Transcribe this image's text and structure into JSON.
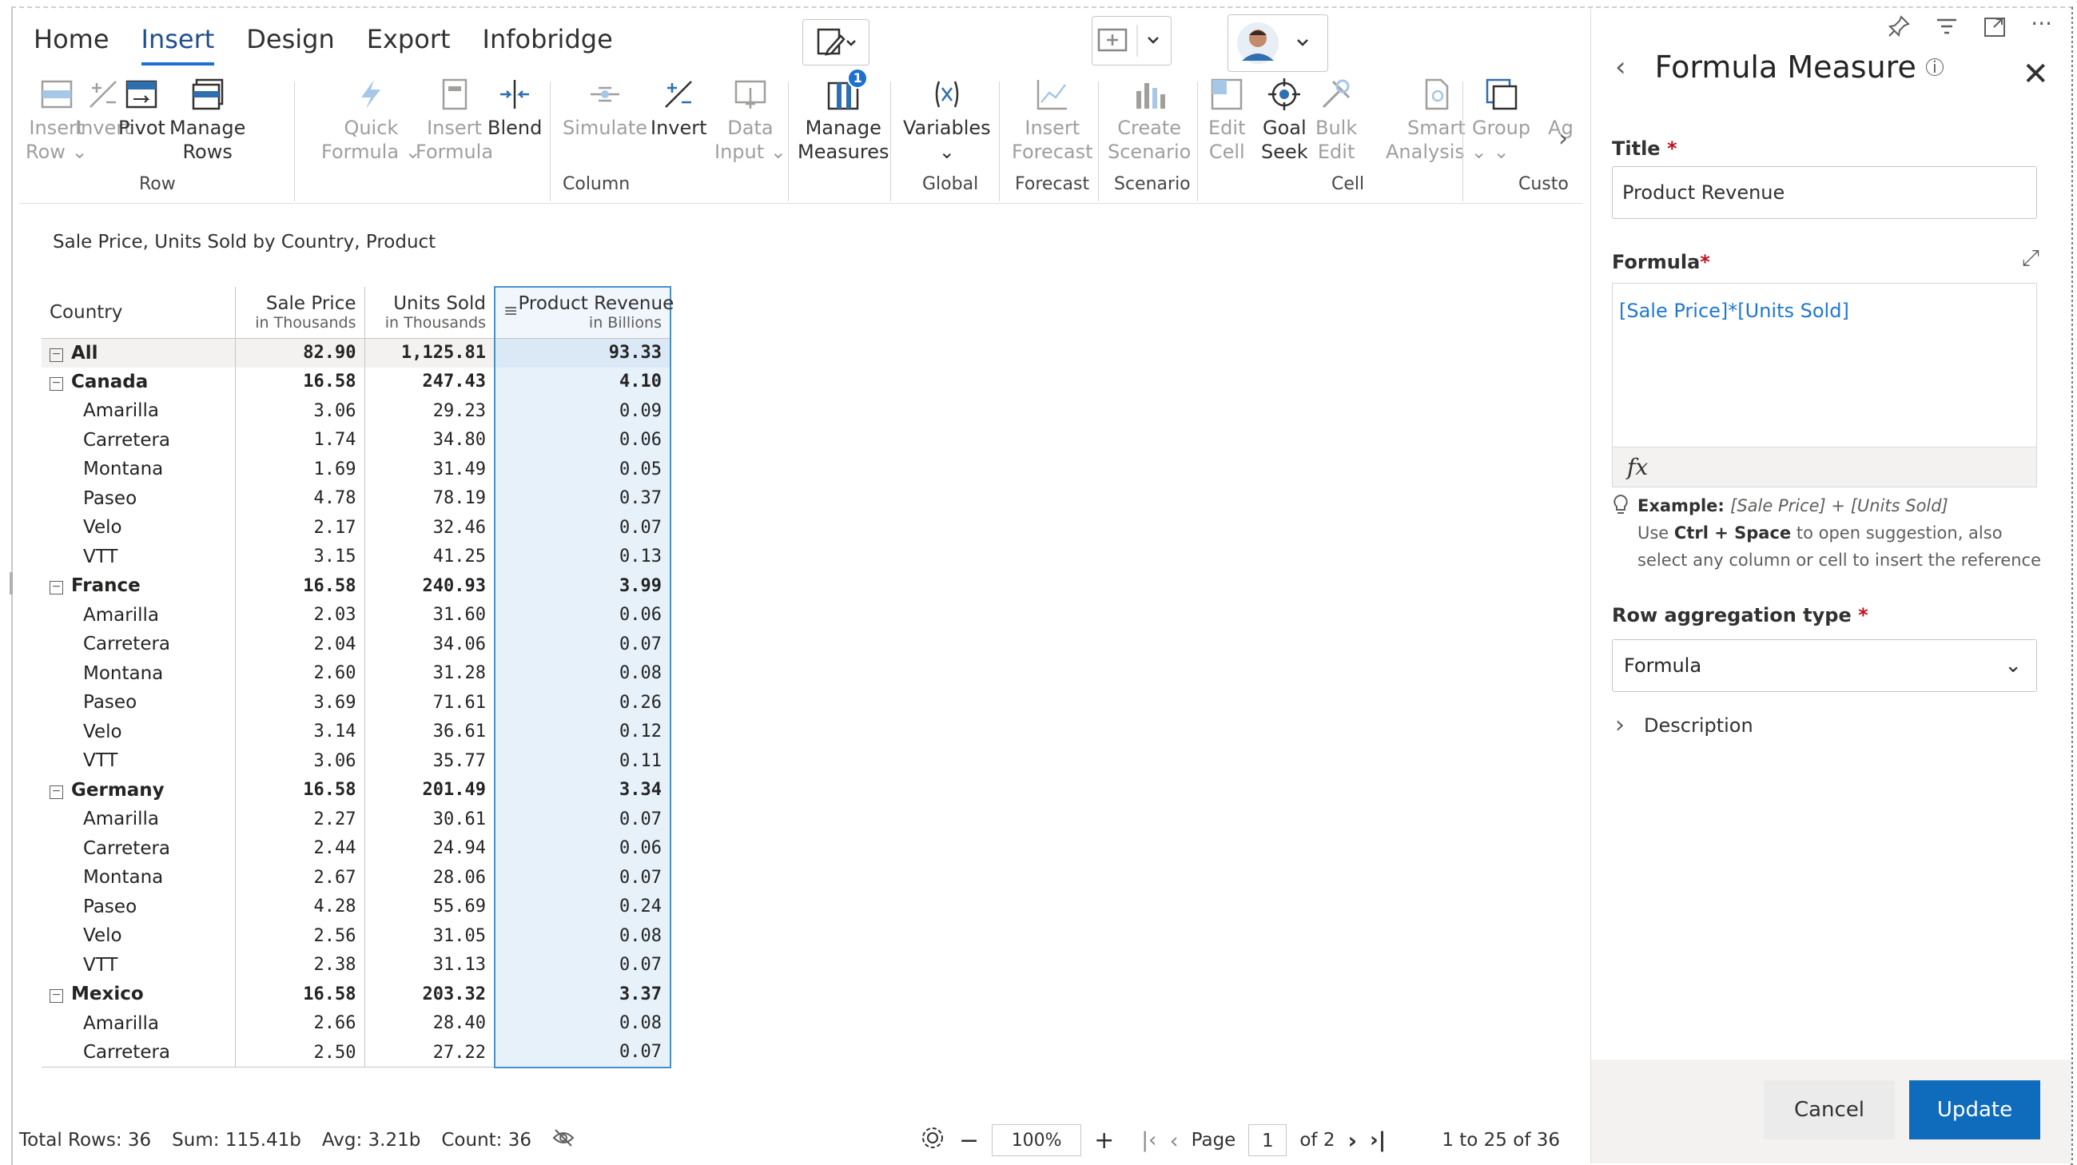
{
  "ribbon": {
    "tabs": [
      {
        "label": "Home",
        "active": false
      },
      {
        "label": "Insert",
        "active": true
      },
      {
        "label": "Design",
        "active": false
      },
      {
        "label": "Export",
        "active": false
      },
      {
        "label": "Infobridge",
        "active": false
      }
    ],
    "buttons": {
      "insert_row": [
        "Insert",
        "Row"
      ],
      "invert_row": "Invert",
      "pivot": "Pivot",
      "manage_rows": [
        "Manage",
        "Rows"
      ],
      "quick_formula": [
        "Quick",
        "Formula"
      ],
      "insert_formula": [
        "Insert",
        "Formula"
      ],
      "blend": "Blend",
      "simulate": "Simulate",
      "invert_col": "Invert",
      "data_input": [
        "Data",
        "Input"
      ],
      "manage_measures": [
        "Manage",
        "Measures"
      ],
      "manage_measures_badge": "1",
      "variables": "Variables",
      "insert_forecast": [
        "Insert",
        "Forecast"
      ],
      "create_scenario": [
        "Create",
        "Scenario"
      ],
      "edit_cell": [
        "Edit",
        "Cell"
      ],
      "goal_seek": [
        "Goal",
        "Seek"
      ],
      "bulk_edit": [
        "Bulk",
        "Edit"
      ],
      "smart_analysis": [
        "Smart",
        "Analysis"
      ],
      "group": "Group",
      "truncated": "Ag"
    },
    "groups": {
      "row": "Row",
      "column": "Column",
      "global": "Global",
      "forecast": "Forecast",
      "scenario": "Scenario",
      "cell": "Cell",
      "custom": "Custo"
    }
  },
  "visual": {
    "subtitle": "Sale Price, Units Sold by Country, Product",
    "columns": [
      {
        "label": "Country",
        "sub": ""
      },
      {
        "label": "Sale Price",
        "sub": "in Thousands"
      },
      {
        "label": "Units Sold",
        "sub": "in Thousands"
      },
      {
        "label": "Product Revenue",
        "sub": "in Billions"
      }
    ],
    "rows": [
      {
        "label": "All",
        "sale": "82.90",
        "units": "1,125.81",
        "rev": "93.33",
        "kind": "all"
      },
      {
        "label": "Canada",
        "sale": "16.58",
        "units": "247.43",
        "rev": "4.10",
        "kind": "group"
      },
      {
        "label": "Amarilla",
        "sale": "3.06",
        "units": "29.23",
        "rev": "0.09",
        "kind": "child"
      },
      {
        "label": "Carretera",
        "sale": "1.74",
        "units": "34.80",
        "rev": "0.06",
        "kind": "child"
      },
      {
        "label": "Montana",
        "sale": "1.69",
        "units": "31.49",
        "rev": "0.05",
        "kind": "child"
      },
      {
        "label": "Paseo",
        "sale": "4.78",
        "units": "78.19",
        "rev": "0.37",
        "kind": "child"
      },
      {
        "label": "Velo",
        "sale": "2.17",
        "units": "32.46",
        "rev": "0.07",
        "kind": "child"
      },
      {
        "label": "VTT",
        "sale": "3.15",
        "units": "41.25",
        "rev": "0.13",
        "kind": "child"
      },
      {
        "label": "France",
        "sale": "16.58",
        "units": "240.93",
        "rev": "3.99",
        "kind": "group"
      },
      {
        "label": "Amarilla",
        "sale": "2.03",
        "units": "31.60",
        "rev": "0.06",
        "kind": "child"
      },
      {
        "label": "Carretera",
        "sale": "2.04",
        "units": "34.06",
        "rev": "0.07",
        "kind": "child"
      },
      {
        "label": "Montana",
        "sale": "2.60",
        "units": "31.28",
        "rev": "0.08",
        "kind": "child"
      },
      {
        "label": "Paseo",
        "sale": "3.69",
        "units": "71.61",
        "rev": "0.26",
        "kind": "child"
      },
      {
        "label": "Velo",
        "sale": "3.14",
        "units": "36.61",
        "rev": "0.12",
        "kind": "child"
      },
      {
        "label": "VTT",
        "sale": "3.06",
        "units": "35.77",
        "rev": "0.11",
        "kind": "child"
      },
      {
        "label": "Germany",
        "sale": "16.58",
        "units": "201.49",
        "rev": "3.34",
        "kind": "group"
      },
      {
        "label": "Amarilla",
        "sale": "2.27",
        "units": "30.61",
        "rev": "0.07",
        "kind": "child"
      },
      {
        "label": "Carretera",
        "sale": "2.44",
        "units": "24.94",
        "rev": "0.06",
        "kind": "child"
      },
      {
        "label": "Montana",
        "sale": "2.67",
        "units": "28.06",
        "rev": "0.07",
        "kind": "child"
      },
      {
        "label": "Paseo",
        "sale": "4.28",
        "units": "55.69",
        "rev": "0.24",
        "kind": "child"
      },
      {
        "label": "Velo",
        "sale": "2.56",
        "units": "31.05",
        "rev": "0.08",
        "kind": "child"
      },
      {
        "label": "VTT",
        "sale": "2.38",
        "units": "31.13",
        "rev": "0.07",
        "kind": "child"
      },
      {
        "label": "Mexico",
        "sale": "16.58",
        "units": "203.32",
        "rev": "3.37",
        "kind": "group"
      },
      {
        "label": "Amarilla",
        "sale": "2.66",
        "units": "28.40",
        "rev": "0.08",
        "kind": "child"
      },
      {
        "label": "Carretera",
        "sale": "2.50",
        "units": "27.22",
        "rev": "0.07",
        "kind": "child"
      }
    ]
  },
  "footer": {
    "total_rows": "Total Rows: 36",
    "sum": "Sum: 115.41b",
    "avg": "Avg: 3.21b",
    "count": "Count: 36",
    "zoom": "100%",
    "page_label": "Page",
    "page": "1",
    "of_pages": "of 2",
    "range": "1 to 25 of 36"
  },
  "panel": {
    "title": "Formula Measure",
    "title_label": "Title",
    "title_value": "Product Revenue",
    "formula_label": "Formula",
    "formula_value": "[Sale Price]*[Units Sold]",
    "fx": "fx",
    "example_label": "Example",
    "example_value": "[Sale Price] + [Units Sold]",
    "hint_use": "Use",
    "hint_keys": "Ctrl + Space",
    "hint_rest": "to open suggestion, also select any column or cell to insert the reference",
    "agg_label": "Row aggregation type",
    "agg_value": "Formula",
    "description": "Description",
    "cancel": "Cancel",
    "update": "Update"
  },
  "colors": {
    "accent": "#1f6fd1",
    "update_button": "#0f6cbd",
    "formula_text": "#1f77d1",
    "revenue_column": "#e6f1fa"
  }
}
